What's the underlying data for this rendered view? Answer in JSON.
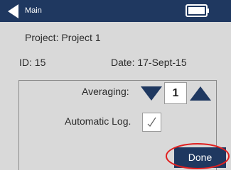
{
  "topbar": {
    "title": "Main",
    "back_icon": "back-arrow-icon",
    "battery_icon": "battery-icon"
  },
  "project": {
    "text": "Project: Project 1"
  },
  "info": {
    "id_text": "ID: 15",
    "date_text": "Date: 17-Sept-15"
  },
  "settings": {
    "averaging_label": "Averaging:",
    "averaging_value": "1",
    "down_icon": "triangle-down-icon",
    "up_icon": "triangle-up-icon",
    "auto_log_label": "Automatic Log.",
    "auto_log_checked": true,
    "check_icon": "checkmark-icon"
  },
  "actions": {
    "done_label": "Done"
  },
  "colors": {
    "header": "#1f3860",
    "background": "#d9d9d9",
    "highlight": "#e02020"
  }
}
